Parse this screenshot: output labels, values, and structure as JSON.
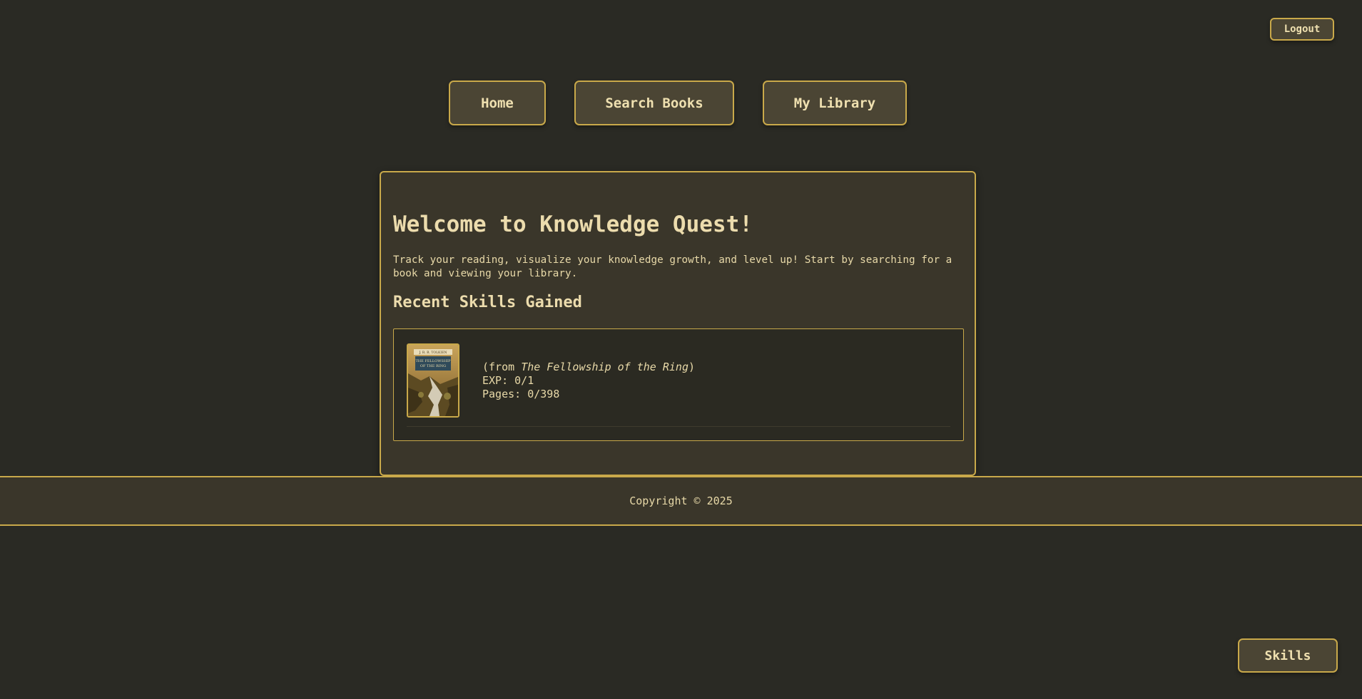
{
  "header": {
    "logout_label": "Logout"
  },
  "nav": {
    "home_label": "Home",
    "search_label": "Search Books",
    "library_label": "My Library"
  },
  "main": {
    "title": "Welcome to Knowledge Quest!",
    "intro": "Track your reading, visualize your knowledge growth, and level up! Start by searching for a book and viewing your library.",
    "recent_heading": "Recent Skills Gained",
    "skills": [
      {
        "from_prefix": "(from ",
        "book_title": "The Fellowship of the Ring",
        "from_suffix": ")",
        "exp": "EXP: 0/1",
        "pages": "Pages: 0/398",
        "cover": {
          "author": "J. R. R. TOLKIEN",
          "title_line1": "THE FELLOWSHIP",
          "title_line2": "OF THE RING"
        }
      }
    ]
  },
  "footer": {
    "copyright": "Copyright © 2025"
  },
  "floating": {
    "skills_label": "Skills"
  },
  "colors": {
    "background": "#2a2a24",
    "panel": "#3a362a",
    "button": "#4b4534",
    "accent_border": "#c9a94a",
    "text": "#e8d9a8"
  }
}
